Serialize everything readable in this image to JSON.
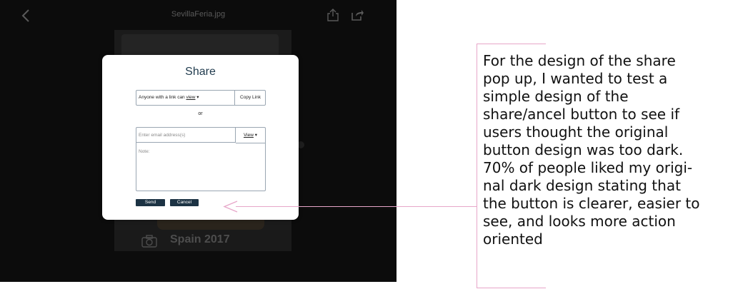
{
  "app": {
    "title": "SevillaFeria.jpg",
    "caption": "Spain 2017",
    "icons": [
      "back-icon",
      "upload-icon",
      "share-icon",
      "camera-icon"
    ]
  },
  "dialog": {
    "title": "Share",
    "link_prefix": "Anyone with a link can ",
    "link_permission": "view",
    "dropdown_arrow": " ▾",
    "copy_link": "Copy Link",
    "or": "or",
    "email_placeholder": "Enter email address(s)",
    "email_permission": "View",
    "note_placeholder": "Note:",
    "send": "Send",
    "cancel": "Cancel"
  },
  "annotation": {
    "text": "For the design of the share\npop up, I wanted to test a\nsimple design of the\nshare/ancel button to see if\nusers thought the original\nbutton design was too dark.\n70% of people liked my origi-\nnal dark design stating that\nthe button is clearer, easier to\nsee, and looks more action\noriented"
  },
  "colors": {
    "app_background": "#0c0c0c",
    "button": "#1c3344",
    "title": "#1f3a4d",
    "annotation_line": "#e7a6c9"
  }
}
